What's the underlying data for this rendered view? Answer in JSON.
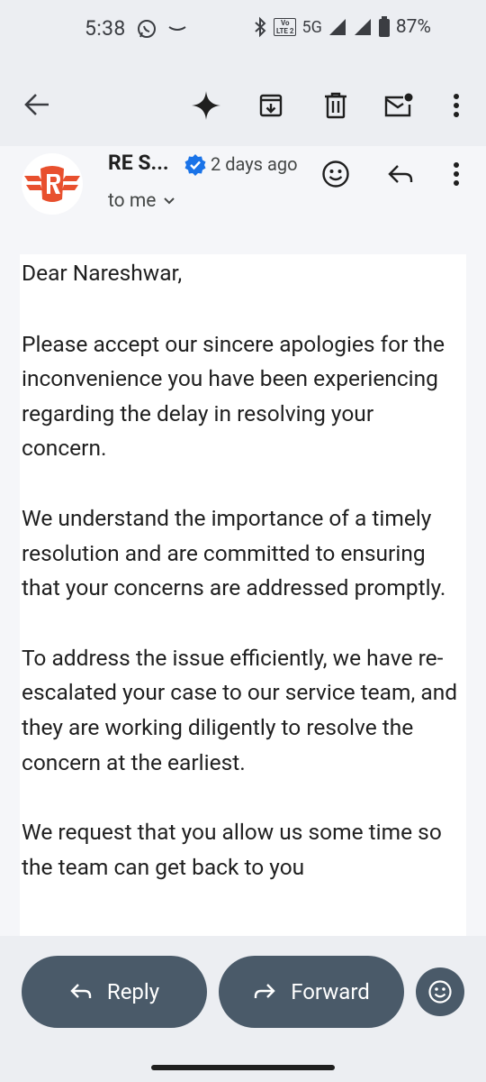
{
  "status_bar": {
    "time": "5:38",
    "network": "5G",
    "volte": [
      "Vo",
      "LTE 2"
    ],
    "battery": "87%"
  },
  "app_bar": {
    "icons": [
      "back-arrow-icon",
      "gemini-sparkle-icon",
      "archive-icon",
      "delete-icon",
      "mark-unread-icon",
      "more-vert-icon"
    ]
  },
  "header": {
    "sender": "RE S...",
    "date": "2 days ago",
    "recipient": "to me"
  },
  "body": {
    "greeting": "Dear Nareshwar,",
    "paragraph_1": "Please accept our sincere apologies for the inconvenience you have been experiencing regarding the delay in resolving your concern.",
    "paragraph_2": "We understand the importance of a timely resolution and are committed to ensuring that your concerns are addressed promptly.",
    "paragraph_3": "To address the issue efficiently, we have re-escalated your case to our service team, and they are working diligently to resolve the concern at the earliest.",
    "paragraph_4": "We request that you allow us some time so the team can get back to you"
  },
  "actions": {
    "reply": "Reply",
    "forward": "Forward"
  },
  "colors": {
    "accent": "#4a5a69",
    "brand": "#e8502e",
    "verified": "#1a73e8"
  }
}
